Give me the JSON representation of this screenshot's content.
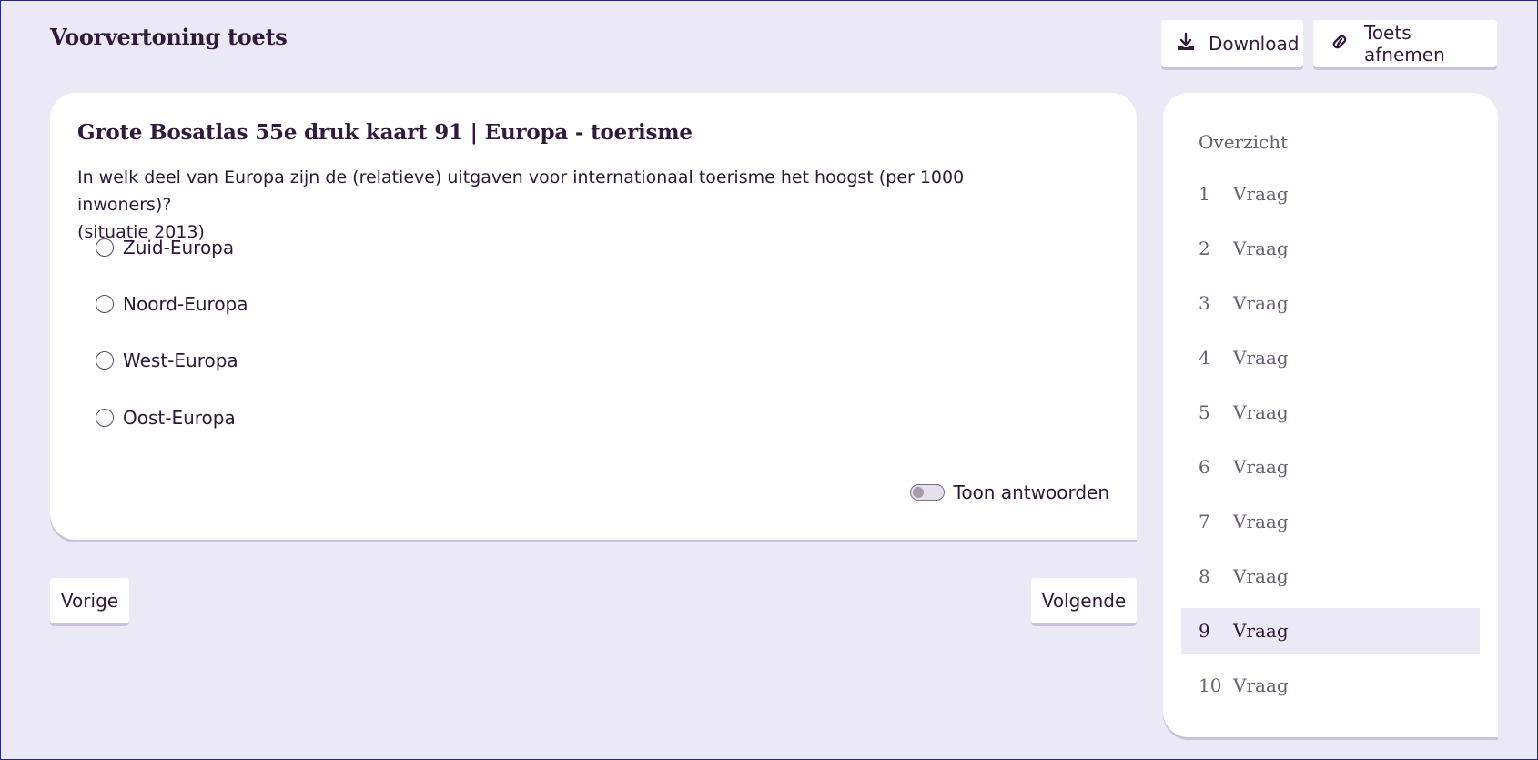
{
  "header": {
    "title": "Voorvertoning toets",
    "download_label": "Download",
    "take_test_label": "Toets afnemen"
  },
  "question": {
    "title": "Grote Bosatlas 55e druk kaart 91 | Europa - toerisme",
    "text_line1": "In welk deel van Europa zijn de (relatieve) uitgaven voor internationaal toerisme het hoogst (per 1000 inwoners)?",
    "text_line2": "(situatie 2013)",
    "options": [
      "Zuid-Europa",
      "Noord-Europa",
      "West-Europa",
      "Oost-Europa"
    ],
    "show_answers_label": "Toon antwoorden"
  },
  "nav": {
    "prev_label": "Vorige",
    "next_label": "Volgende"
  },
  "sidebar": {
    "heading": "Overzicht",
    "items": [
      {
        "num": "1",
        "label": "Vraag"
      },
      {
        "num": "2",
        "label": "Vraag"
      },
      {
        "num": "3",
        "label": "Vraag"
      },
      {
        "num": "4",
        "label": "Vraag"
      },
      {
        "num": "5",
        "label": "Vraag"
      },
      {
        "num": "6",
        "label": "Vraag"
      },
      {
        "num": "7",
        "label": "Vraag"
      },
      {
        "num": "8",
        "label": "Vraag"
      },
      {
        "num": "9",
        "label": "Vraag"
      },
      {
        "num": "10",
        "label": "Vraag"
      }
    ],
    "active_index": 8
  },
  "icons": {
    "download": "download-icon",
    "link": "link-icon"
  },
  "colors": {
    "background": "#ebe9f5",
    "text": "#321a3c",
    "muted": "#6b5f74",
    "shadow": "#cbc3de"
  }
}
